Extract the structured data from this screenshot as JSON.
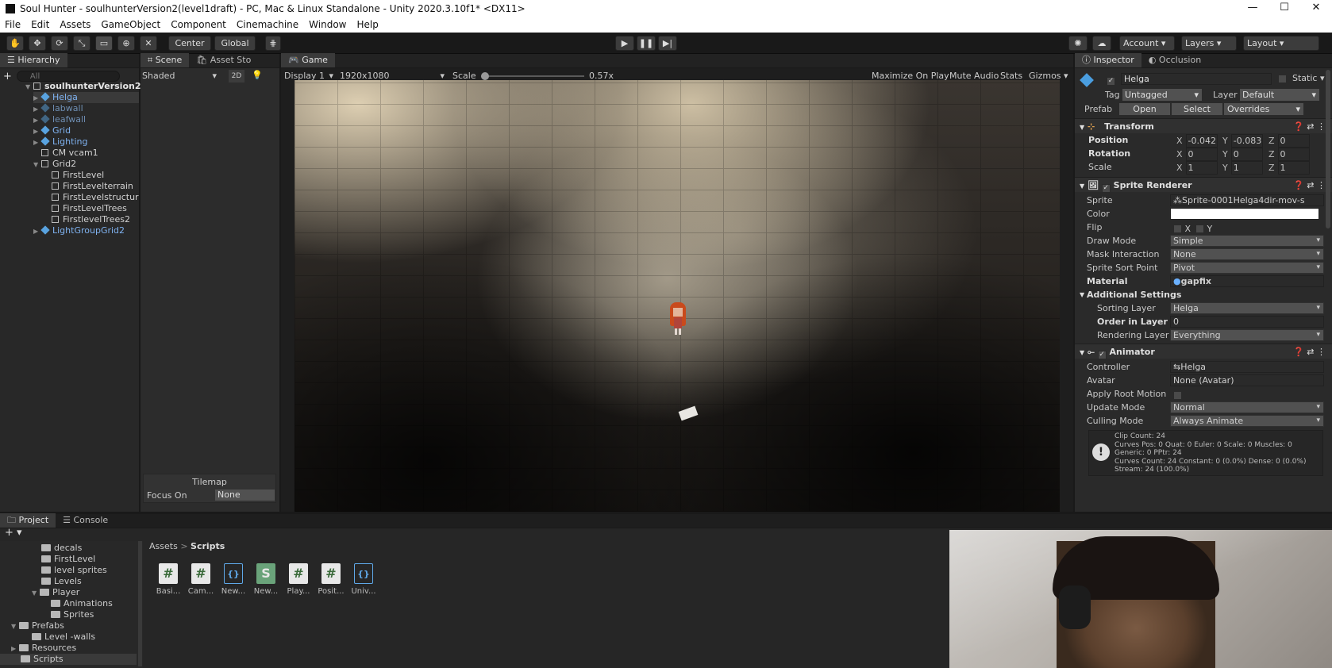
{
  "window": {
    "title": "Soul Hunter - soulhunterVersion2(level1draft) - PC, Mac & Linux Standalone - Unity 2020.3.10f1* <DX11>",
    "minimize": "—",
    "maximize": "☐",
    "close": "✕"
  },
  "menu": [
    "File",
    "Edit",
    "Assets",
    "GameObject",
    "Component",
    "Cinemachine",
    "Window",
    "Help"
  ],
  "toolbar": {
    "center": "Center",
    "global": "Global",
    "account": "Account",
    "layers": "Layers",
    "layout": "Layout"
  },
  "hierarchy": {
    "tab": "Hierarchy",
    "search_placeholder": "All",
    "add": "+",
    "scene": "soulhunterVersion2",
    "items": [
      {
        "label": "Helga",
        "style": "blue"
      },
      {
        "label": "labwall",
        "style": "faded"
      },
      {
        "label": "leafwall",
        "style": "faded"
      },
      {
        "label": "Grid",
        "style": "blue"
      },
      {
        "label": "Lighting",
        "style": "blue"
      },
      {
        "label": "CM vcam1",
        "style": "plain"
      },
      {
        "label": "Grid2",
        "style": "plain"
      },
      {
        "label": "FirstLevel",
        "style": "plain"
      },
      {
        "label": "FirstLevelterrain",
        "style": "plain"
      },
      {
        "label": "FirstLevelstructures",
        "style": "plain"
      },
      {
        "label": "FirstLevelTrees",
        "style": "plain"
      },
      {
        "label": "FirstlevelTrees2",
        "style": "plain"
      },
      {
        "label": "LightGroupGrid2",
        "style": "blue"
      }
    ]
  },
  "scene_panel": {
    "tab_scene": "Scene",
    "tab_asset_store": "Asset Store",
    "shading": "Shaded",
    "mode_2d": "2D",
    "tilemap_title": "Tilemap",
    "focus_on_label": "Focus On",
    "focus_on_value": "None"
  },
  "game": {
    "tab": "Game",
    "display": "Display 1",
    "resolution": "1920x1080",
    "scale_label": "Scale",
    "scale_value": "0.57x",
    "scale_level": 0.0,
    "maximize": "Maximize On Play",
    "mute": "Mute Audio",
    "stats": "Stats",
    "gizmos": "Gizmos"
  },
  "inspector": {
    "tab": "Inspector",
    "tab_occlusion": "Occlusion",
    "object_name": "Helga",
    "static_label": "Static",
    "tag_label": "Tag",
    "tag_value": "Untagged",
    "layer_label": "Layer",
    "layer_value": "Default",
    "prefab_label": "Prefab",
    "prefab_open": "Open",
    "prefab_select": "Select",
    "prefab_overrides": "Overrides",
    "transform": {
      "title": "Transform",
      "position_label": "Position",
      "rotation_label": "Rotation",
      "scale_label": "Scale",
      "position": [
        "-0.042",
        "-0.083",
        "0"
      ],
      "rotation": [
        "0",
        "0",
        "0"
      ],
      "scale": [
        "1",
        "1",
        "1"
      ],
      "axes": [
        "X",
        "Y",
        "Z"
      ]
    },
    "sprite_renderer": {
      "title": "Sprite Renderer",
      "rows": [
        {
          "label": "Sprite",
          "value": "Sprite-0001Helga4dir-mov-s"
        },
        {
          "label": "Color",
          "value": ""
        },
        {
          "label": "Flip",
          "value": ""
        },
        {
          "label": "Draw Mode",
          "value": "Simple"
        },
        {
          "label": "Mask Interaction",
          "value": "None"
        },
        {
          "label": "Sprite Sort Point",
          "value": "Pivot"
        },
        {
          "label": "Material",
          "value": "gapfix"
        }
      ],
      "flip_x": "X",
      "flip_y": "Y",
      "additional": "Additional Settings",
      "sub_rows": [
        {
          "label": "Sorting Layer",
          "value": "Helga"
        },
        {
          "label": "Order in Layer",
          "value": "0"
        },
        {
          "label": "Rendering Layer M",
          "value": "Everything"
        }
      ]
    },
    "animator": {
      "title": "Animator",
      "rows": [
        {
          "label": "Controller",
          "value": "Helga"
        },
        {
          "label": "Avatar",
          "value": "None (Avatar)"
        },
        {
          "label": "Apply Root Motion",
          "value": ""
        },
        {
          "label": "Update Mode",
          "value": "Normal"
        },
        {
          "label": "Culling Mode",
          "value": "Always Animate"
        }
      ],
      "info": [
        "Clip Count: 24",
        "Curves Pos: 0 Quat: 0 Euler: 0 Scale: 0 Muscles: 0 Generic: 0 PPtr: 24",
        "Curves Count: 24 Constant: 0 (0.0%) Dense: 0 (0.0%)",
        "Stream: 24 (100.0%)"
      ]
    }
  },
  "project": {
    "tab": "Project",
    "tab_console": "Console",
    "add": "+",
    "tree": [
      {
        "label": "decals",
        "indent": 3
      },
      {
        "label": "FirstLevel",
        "indent": 3
      },
      {
        "label": "level sprites",
        "indent": 3
      },
      {
        "label": "Levels",
        "indent": 3
      },
      {
        "label": "Player",
        "indent": 3
      },
      {
        "label": "Animations",
        "indent": 5
      },
      {
        "label": "Sprites",
        "indent": 5
      },
      {
        "label": "Prefabs",
        "indent": 1
      },
      {
        "label": "Level -walls",
        "indent": 3
      },
      {
        "label": "Resources",
        "indent": 1
      },
      {
        "label": "Scripts",
        "indent": 1
      }
    ],
    "breadcrumb_root": "Assets",
    "breadcrumb_sep": ">",
    "breadcrumb_current": "Scripts",
    "assets": [
      {
        "label": "Basi...",
        "icon": "#"
      },
      {
        "label": "Cam...",
        "icon": "#"
      },
      {
        "label": "New...",
        "icon": "{}"
      },
      {
        "label": "New...",
        "icon": "S"
      },
      {
        "label": "Play...",
        "icon": "#"
      },
      {
        "label": "Posit...",
        "icon": "#"
      },
      {
        "label": "Univ...",
        "icon": "{}"
      }
    ]
  }
}
